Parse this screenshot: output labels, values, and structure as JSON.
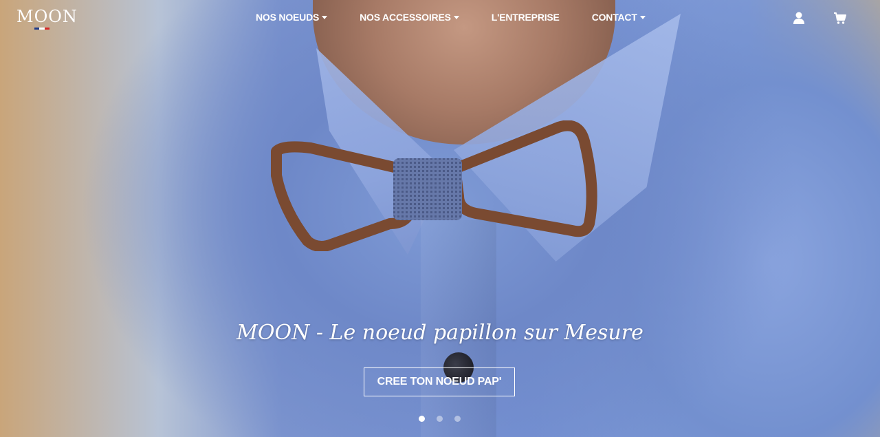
{
  "logo": {
    "text": "MOON",
    "flag_colors": [
      "#1f3a8a",
      "#ffffff",
      "#d62828"
    ]
  },
  "nav": {
    "items": [
      {
        "label": "NOS NOEUDS",
        "has_dropdown": true
      },
      {
        "label": "NOS ACCESSOIRES",
        "has_dropdown": true
      },
      {
        "label": "L'ENTREPRISE",
        "has_dropdown": false
      },
      {
        "label": "CONTACT",
        "has_dropdown": true
      }
    ],
    "icons": [
      "user-icon",
      "cart-icon"
    ]
  },
  "hero": {
    "tagline": "MOON - Le noeud papillon sur Mesure",
    "cta_label": "CREE TON NOEUD PAP'",
    "slide_count": 3,
    "active_slide": 1
  },
  "colors": {
    "text": "#ffffff",
    "shirt": "#7591d4",
    "wood": "#7a4a31"
  }
}
